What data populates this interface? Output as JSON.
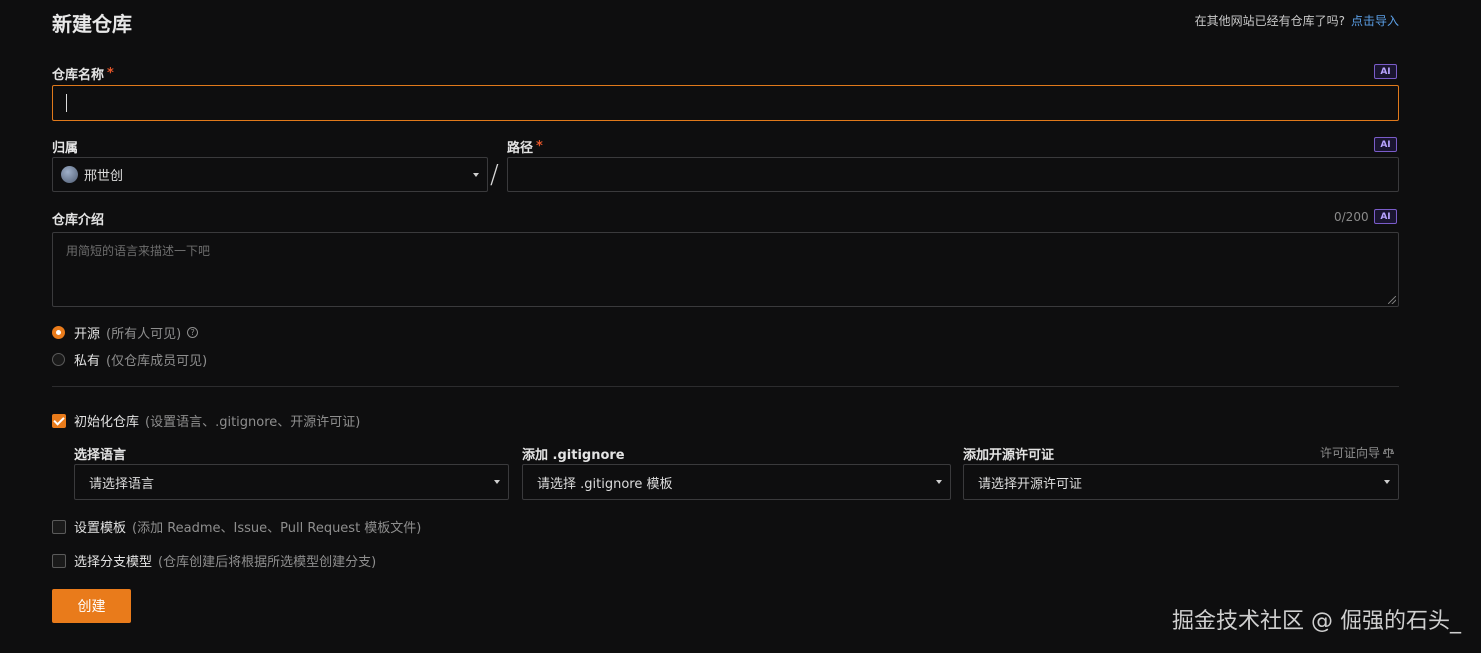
{
  "page": {
    "title": "新建仓库",
    "import_hint": "在其他网站已经有仓库了吗?",
    "import_link": "点击导入"
  },
  "repo_name": {
    "label": "仓库名称",
    "required_mark": "*",
    "ai": "AI",
    "value": ""
  },
  "owner": {
    "label": "归属",
    "value": "邢世创"
  },
  "path": {
    "label": "路径",
    "required_mark": "*",
    "ai": "AI",
    "separator": "/",
    "value": ""
  },
  "description": {
    "label": "仓库介绍",
    "counter": "0/200",
    "ai": "AI",
    "placeholder": "用简短的语言来描述一下吧"
  },
  "visibility": {
    "public": {
      "label": "开源",
      "sub": "(所有人可见)",
      "selected": true
    },
    "private": {
      "label": "私有",
      "sub": "(仅仓库成员可见)",
      "selected": false
    }
  },
  "init": {
    "label": "初始化仓库",
    "sub": "(设置语言、.gitignore、开源许可证)",
    "checked": true,
    "language": {
      "label": "选择语言",
      "value": "请选择语言"
    },
    "gitignore": {
      "label": "添加 .gitignore",
      "value": "请选择 .gitignore 模板"
    },
    "license": {
      "label": "添加开源许可证",
      "value": "请选择开源许可证",
      "guide": "许可证向导"
    }
  },
  "template": {
    "label": "设置模板",
    "sub": "(添加 Readme、Issue、Pull Request 模板文件)",
    "checked": false
  },
  "branch_model": {
    "label": "选择分支模型",
    "sub": "(仓库创建后将根据所选模型创建分支)",
    "checked": false
  },
  "create_button": "创建",
  "watermark": "掘金技术社区 @ 倔强的石头_",
  "colors": {
    "accent": "#e97b1b",
    "link": "#5b9fe6",
    "ai": "#7a5cc9",
    "background": "#0e0e0f"
  }
}
